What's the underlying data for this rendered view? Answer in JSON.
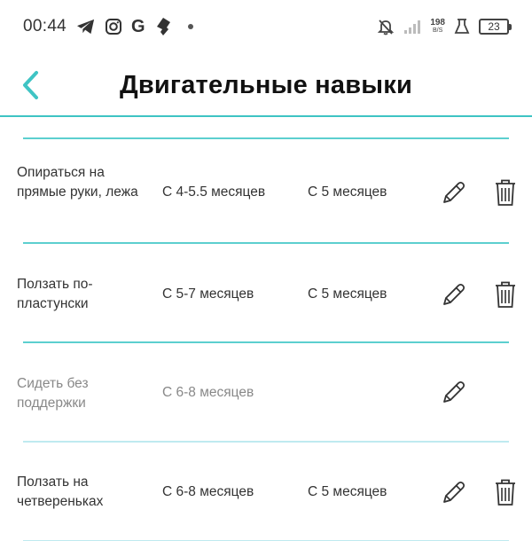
{
  "status_bar": {
    "time": "00:44",
    "left_icons": [
      "telegram-icon",
      "instagram-icon",
      "google-icon",
      "shield-icon",
      "dot-icon"
    ],
    "right_icons": [
      "bell-off-icon",
      "signal-icon",
      "net-speed",
      "lab-icon",
      "battery-icon"
    ],
    "google_letter": "G",
    "net_speed_value": "198",
    "net_speed_unit": "B/S",
    "battery_level": "23"
  },
  "header": {
    "title": "Двигательные навыки",
    "back_icon": "chevron-left-icon",
    "accent_color": "#3fc4c4"
  },
  "skills": [
    {
      "name": "Опираться на прямые руки, лежа",
      "expected": "С 4-5.5 месяцев",
      "actual": "С 5 месяцев",
      "has_delete": true,
      "muted": false
    },
    {
      "name": "Ползать по-пластунски",
      "expected": "С 5-7 месяцев",
      "actual": "С 5 месяцев",
      "has_delete": true,
      "muted": false
    },
    {
      "name": "Сидеть без поддержки",
      "expected": "С 6-8 месяцев",
      "actual": "",
      "has_delete": false,
      "muted": true
    },
    {
      "name": "Ползать на четвереньках",
      "expected": "С 6-8 месяцев",
      "actual": "С 5 месяцев",
      "has_delete": true,
      "muted": false
    }
  ],
  "icons": {
    "edit": "pencil-icon",
    "delete": "trash-icon"
  }
}
